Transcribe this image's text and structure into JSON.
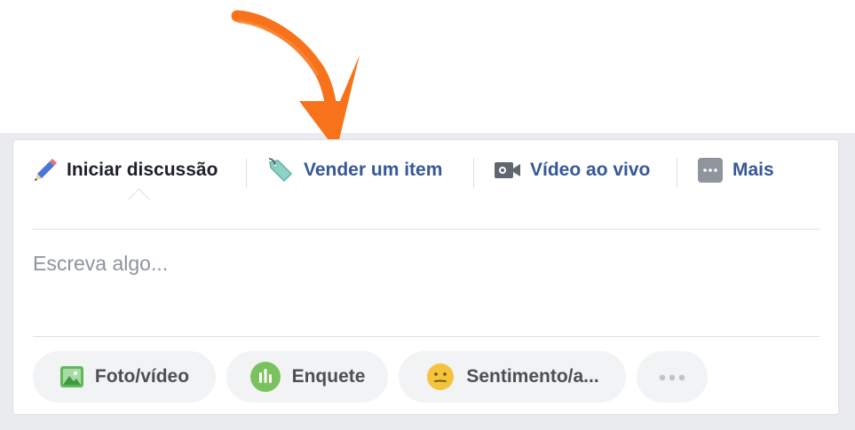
{
  "tabs": [
    {
      "label": "Iniciar discussão",
      "icon": "pencil-icon",
      "active": true
    },
    {
      "label": "Vender um item",
      "icon": "price-tag-icon"
    },
    {
      "label": "Vídeo ao vivo",
      "icon": "video-camera-icon"
    },
    {
      "label": "Mais",
      "icon": "more-icon"
    }
  ],
  "composer": {
    "placeholder": "Escreva algo..."
  },
  "actions": [
    {
      "label": "Foto/vídeo",
      "icon": "photo-icon"
    },
    {
      "label": "Enquete",
      "icon": "poll-icon"
    },
    {
      "label": "Sentimento/a...",
      "icon": "smiley-icon"
    },
    {
      "label": "",
      "icon": "ellipsis-icon"
    }
  ],
  "colors": {
    "link_blue": "#365899",
    "arrow_orange": "#f7721a",
    "photo_green": "#5fb95b",
    "poll_green": "#7ac25e",
    "smiley_yellow": "#f5c33b"
  }
}
